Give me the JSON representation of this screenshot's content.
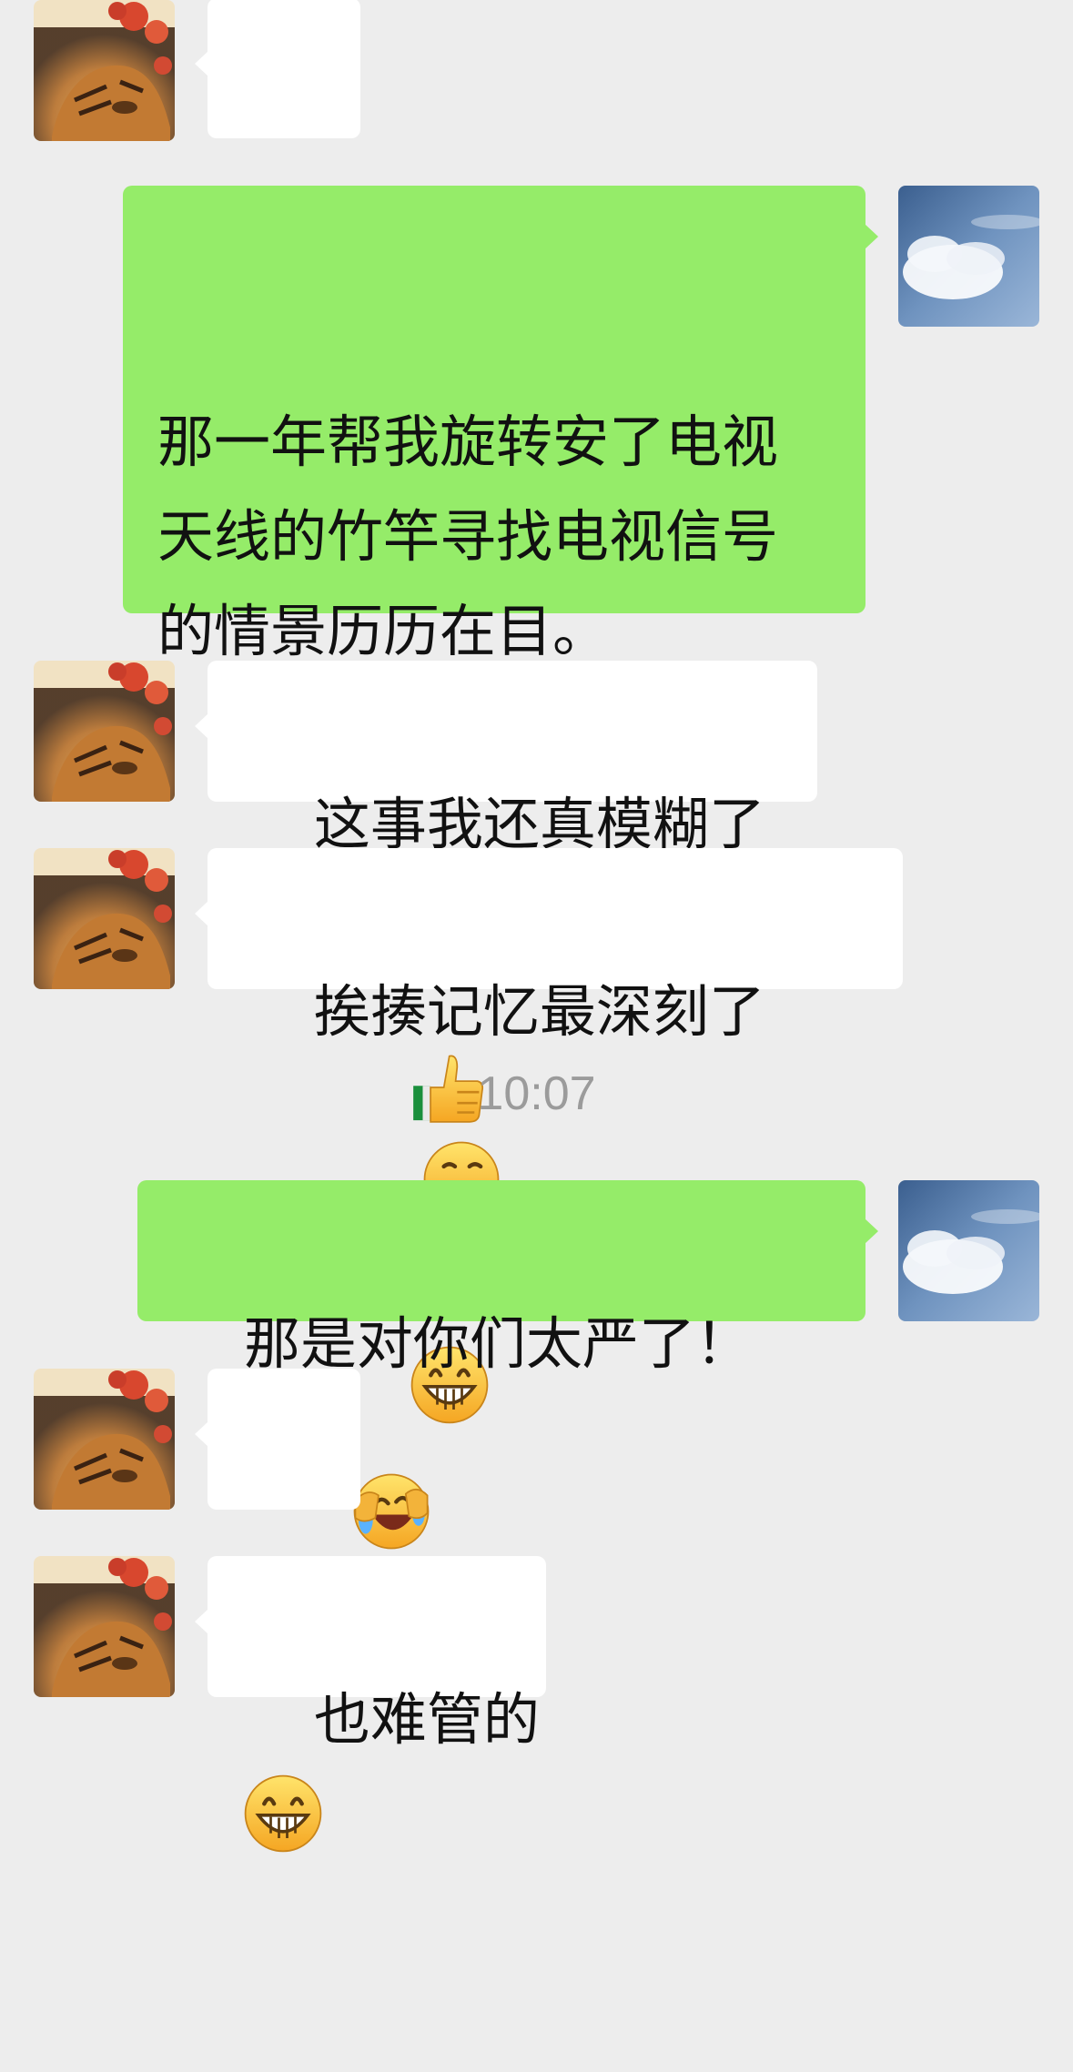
{
  "messages": [
    {
      "side": "in",
      "text": "",
      "emoji": "grin-emoji"
    },
    {
      "side": "out",
      "text": "那一年帮我旋转安了电视天线的竹竿寻找电视信号的情景历历在目。",
      "emoji": "thumbs-up-emoji,grin-emoji"
    },
    {
      "side": "in",
      "text": "这事我还真模糊了"
    },
    {
      "side": "in",
      "text": "挨揍记忆最深刻了",
      "emoji": "hand-over-mouth-emoji"
    },
    {
      "side": "out",
      "text": "那是对你们太严了！",
      "emoji": "rolling-laugh-emoji"
    },
    {
      "side": "in",
      "text": "",
      "emoji": "grin-emoji"
    },
    {
      "side": "in",
      "text": "也难管的"
    }
  ],
  "timestamp": "10:07",
  "colors": {
    "background": "#ededed",
    "outgoing_bubble": "#95ec69",
    "incoming_bubble": "#ffffff",
    "timestamp_text": "#9b9b9b"
  }
}
